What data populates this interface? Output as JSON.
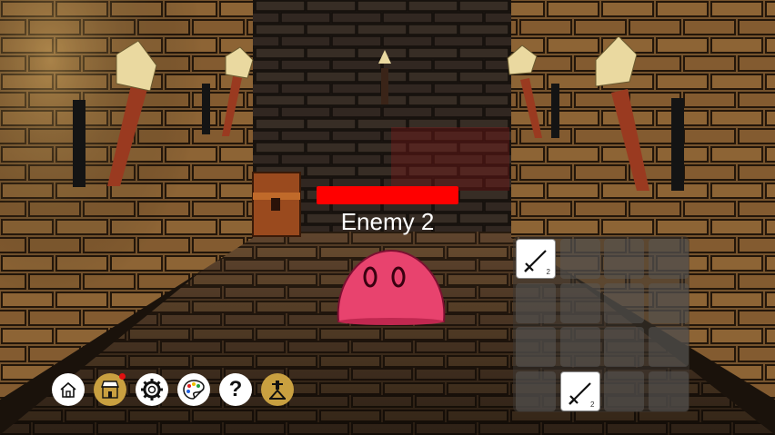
{
  "enemy": {
    "name": "Enemy 2",
    "health_fraction": 1.0,
    "health_color": "#ff0000"
  },
  "inventory": {
    "slots": [
      {
        "item": "sword-icon",
        "count": "2"
      },
      {
        "item": null
      },
      {
        "item": null
      },
      {
        "item": null
      },
      {
        "item": null
      },
      {
        "item": null
      },
      {
        "item": null
      },
      {
        "item": null
      },
      {
        "item": null
      },
      {
        "item": null
      },
      {
        "item": null
      },
      {
        "item": null
      },
      {
        "item": null
      },
      {
        "item": "sword-icon",
        "count": "2"
      },
      {
        "item": null
      },
      {
        "item": null
      }
    ]
  },
  "toolbar": {
    "buttons": [
      {
        "icon": "home-icon"
      },
      {
        "icon": "shop-icon",
        "notification": true
      },
      {
        "icon": "gear-icon"
      },
      {
        "icon": "palette-icon"
      },
      {
        "icon": "help-icon",
        "label": "?"
      },
      {
        "icon": "forge-icon"
      }
    ]
  },
  "colors": {
    "slime": "#e8436e",
    "torch_flame": "#ead9a0",
    "wall": "#6b4a2a"
  }
}
